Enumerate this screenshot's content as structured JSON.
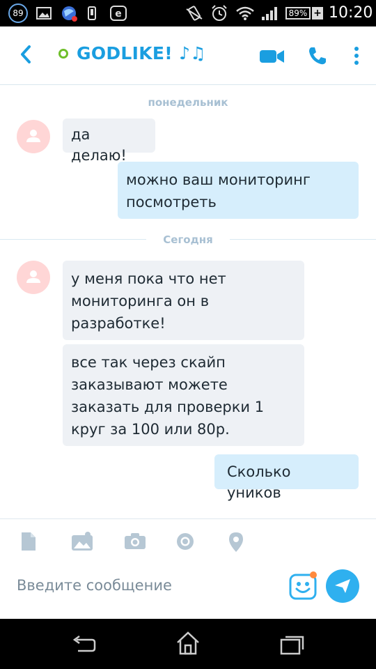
{
  "status_bar": {
    "badge": "89",
    "battery": "89%",
    "battery_plus": "+",
    "time": "10:20"
  },
  "header": {
    "title": "GODLIKE! ♪♫"
  },
  "chat": {
    "day_monday": "понедельник",
    "day_today": "Сегодня",
    "messages": [
      {
        "text": "да делаю!"
      },
      {
        "text": "можно ваш мониторинг посмотреть"
      },
      {
        "text": "у меня пока что нет мониторинга он в разработке!"
      },
      {
        "text": "все так через скайп заказывают можете заказать для проверки 1 круг за 100 или 80р."
      },
      {
        "text": "Сколько уников"
      }
    ]
  },
  "composer": {
    "placeholder": "Введите сообщение"
  },
  "colors": {
    "accent": "#1a9ee0",
    "incoming_bubble": "#eef1f5",
    "outgoing_bubble": "#d6eefc",
    "online_status": "#6fbf2b",
    "avatar_bg": "#ffd6d6"
  }
}
